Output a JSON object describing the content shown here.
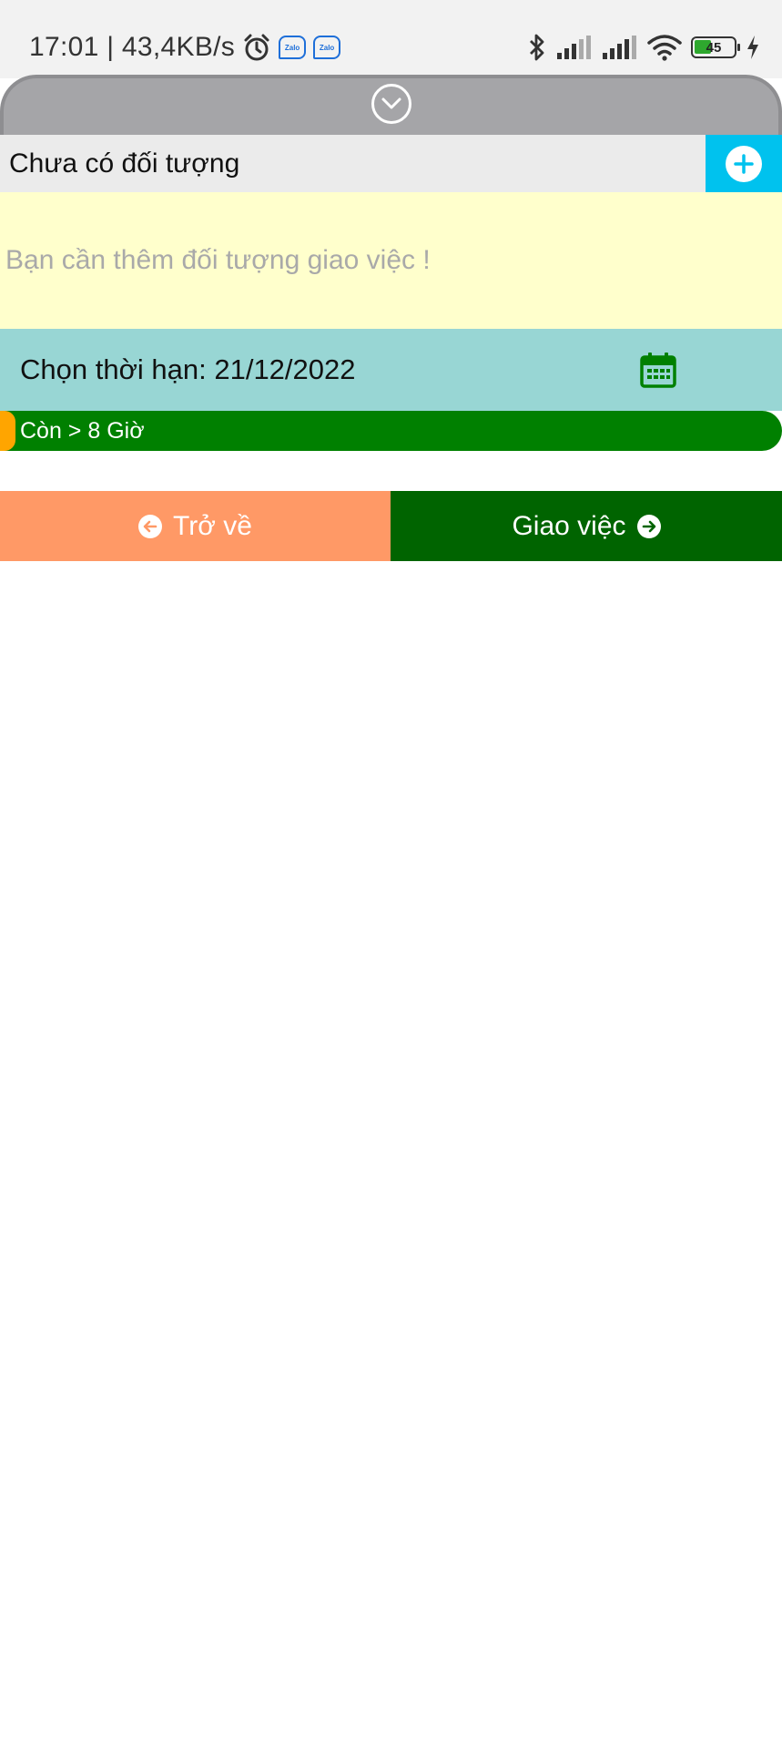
{
  "status_bar": {
    "time_speed": "17:01 | 43,4KB/s",
    "zalo_label": "Zalo",
    "battery_level": "45",
    "icons": [
      "alarm-icon",
      "zalo-icon",
      "zalo-icon",
      "bluetooth-icon",
      "signal-icon",
      "signal-icon",
      "wifi-icon",
      "battery-icon",
      "charging-icon"
    ]
  },
  "target": {
    "label": "Chưa có đối tượng",
    "add_icon": "plus-icon"
  },
  "message": {
    "text": "Bạn cần thêm đối tượng giao việc !"
  },
  "deadline": {
    "label": "Chọn thời hạn: 21/12/2022",
    "icon": "calendar-icon"
  },
  "progress": {
    "label": "Còn > 8 Giờ",
    "value_fraction": 0.02
  },
  "actions": {
    "back_label": "Trở về",
    "assign_label": "Giao việc"
  },
  "colors": {
    "accent_cyan": "#00c2ee",
    "message_bg": "#ffffcc",
    "deadline_bg": "#98d6d4",
    "progress_green": "#008000",
    "progress_orange": "#ffa500",
    "back_button": "#ff9966",
    "assign_button": "#006400"
  }
}
